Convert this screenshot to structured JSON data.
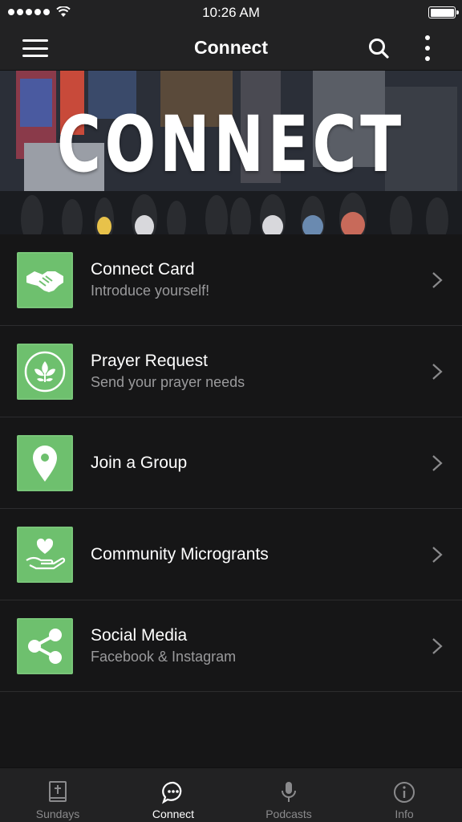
{
  "status": {
    "time": "10:26 AM"
  },
  "header": {
    "title": "Connect"
  },
  "hero": {
    "title": "CONNECT"
  },
  "list": {
    "items": [
      {
        "title": "Connect Card",
        "subtitle": "Introduce yourself!",
        "icon": "handshake-icon"
      },
      {
        "title": "Prayer Request",
        "subtitle": "Send your prayer needs",
        "icon": "leaf-icon"
      },
      {
        "title": "Join a Group",
        "subtitle": "",
        "icon": "map-pin-icon"
      },
      {
        "title": "Community Microgrants",
        "subtitle": "",
        "icon": "heart-hand-icon"
      },
      {
        "title": "Social Media",
        "subtitle": "Facebook & Instagram",
        "icon": "share-icon"
      }
    ]
  },
  "tabs": [
    {
      "label": "Sundays",
      "icon": "bible-icon",
      "active": false
    },
    {
      "label": "Connect",
      "icon": "chat-bubble-icon",
      "active": true
    },
    {
      "label": "Podcasts",
      "icon": "microphone-icon",
      "active": false
    },
    {
      "label": "Info",
      "icon": "info-icon",
      "active": false
    }
  ],
  "colors": {
    "accent": "#6ec06e",
    "background": "#161617",
    "bar": "#222223"
  }
}
